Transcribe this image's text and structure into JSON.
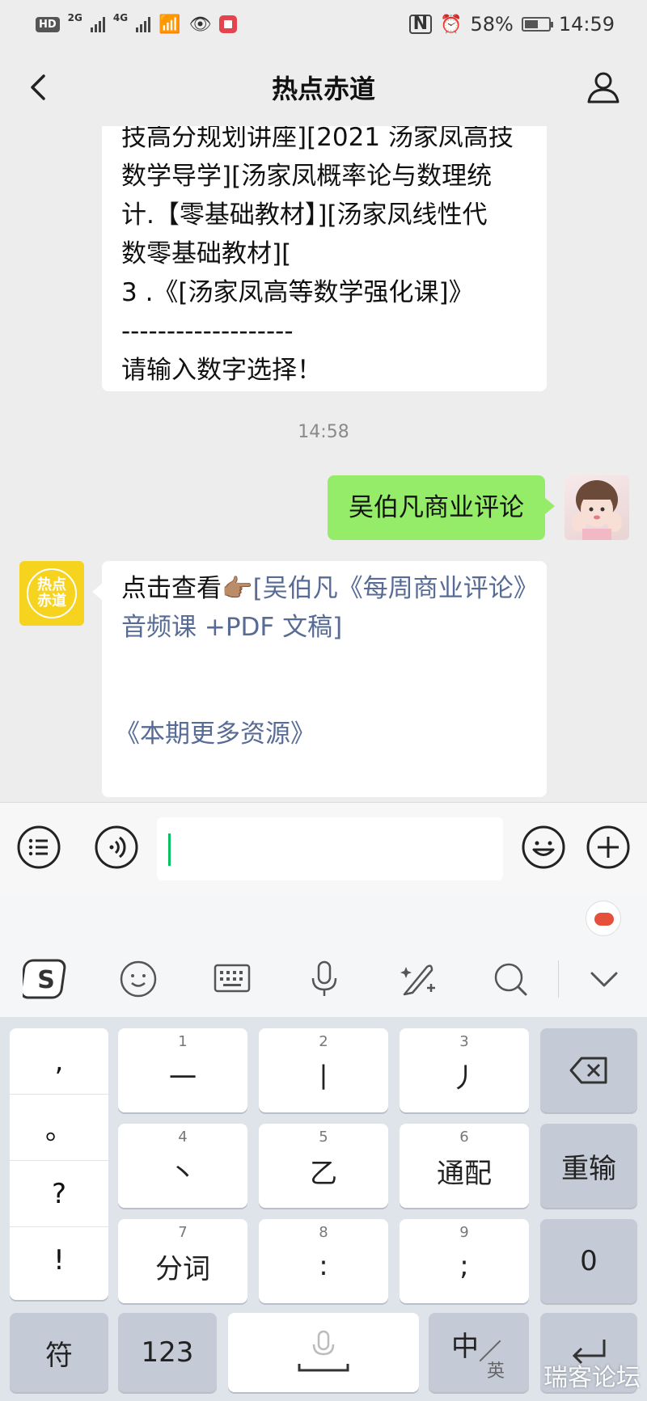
{
  "status_bar": {
    "hd": "HD",
    "net1": "2G",
    "net2": "4G",
    "battery": "58%",
    "battery_fraction": 0.58,
    "time": "14:59"
  },
  "header": {
    "title": "热点赤道"
  },
  "messages": {
    "bot_prev_lines": [
      "技高分规划讲座][2021 汤家凤高技",
      "数学导学][汤家凤概率论与数理统",
      "计.【零基础教材】][汤家凤线性代",
      "数零基础教材][",
      "3 .《[汤家凤高等数学强化课]》",
      "-------------------",
      "请输入数字选择！"
    ],
    "timestamp": "14:58",
    "user_msg": "吴伯凡商业评论",
    "bot_avatar_text": "热点\n赤道",
    "bot_reply_prefix": "点击查看👉🏽",
    "bot_reply_link": "[吴伯凡《每周商业评论》音频课 +PDF 文稿]",
    "bot_more_link": "《本期更多资源》"
  },
  "keyboard": {
    "punct": [
      ",",
      "。",
      "?",
      "!"
    ],
    "keys_row1": [
      {
        "num": "1",
        "label": "一"
      },
      {
        "num": "2",
        "label": "丨"
      },
      {
        "num": "3",
        "label": "丿"
      }
    ],
    "keys_row2": [
      {
        "num": "4",
        "label": "丶"
      },
      {
        "num": "5",
        "label": "乙"
      },
      {
        "num": "6",
        "label": "通配"
      }
    ],
    "keys_row3": [
      {
        "num": "7",
        "label": "分词"
      },
      {
        "num": "8",
        "label": ":"
      },
      {
        "num": "9",
        "label": ";"
      }
    ],
    "reenter": "重输",
    "zero": "0",
    "symbols": "符",
    "numbers": "123",
    "lang_main": "中",
    "lang_alt": "英"
  },
  "watermark": "瑞客论坛",
  "colors": {
    "accent_green": "#95ec69",
    "link": "#576b95",
    "cursor": "#07c160"
  }
}
